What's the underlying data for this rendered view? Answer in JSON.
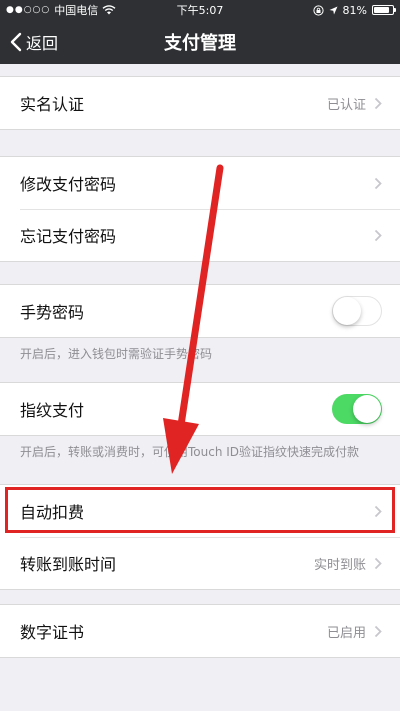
{
  "status_bar": {
    "signal": "●●○○○",
    "carrier": "中国电信",
    "time": "下午5:07",
    "battery": "81%",
    "battery_level": 0.81
  },
  "nav": {
    "back_label": "返回",
    "title": "支付管理"
  },
  "rows": {
    "real_name": {
      "label": "实名认证",
      "value": "已认证"
    },
    "change_password": {
      "label": "修改支付密码"
    },
    "forgot_password": {
      "label": "忘记支付密码"
    },
    "gesture": {
      "label": "手势密码",
      "enabled": false,
      "note": "开启后，进入钱包时需验证手势密码"
    },
    "fingerprint": {
      "label": "指纹支付",
      "enabled": true,
      "note": "开启后，转账或消费时，可使用Touch ID验证指纹快速完成付款"
    },
    "auto_deduct": {
      "label": "自动扣费"
    },
    "transfer_time": {
      "label": "转账到账时间",
      "value": "实时到账"
    },
    "certificate": {
      "label": "数字证书",
      "value": "已启用"
    }
  },
  "colors": {
    "nav_bg": "#2e3033",
    "page_bg": "#efeff4",
    "toggle_on": "#4cd964",
    "annotation_red": "#e02424"
  },
  "icons": {
    "back": "chevron-left-icon",
    "row_arrow": "chevron-right-icon",
    "wifi": "wifi-icon",
    "lock": "orientation-lock-icon",
    "location": "location-arrow-icon",
    "battery": "battery-icon"
  }
}
